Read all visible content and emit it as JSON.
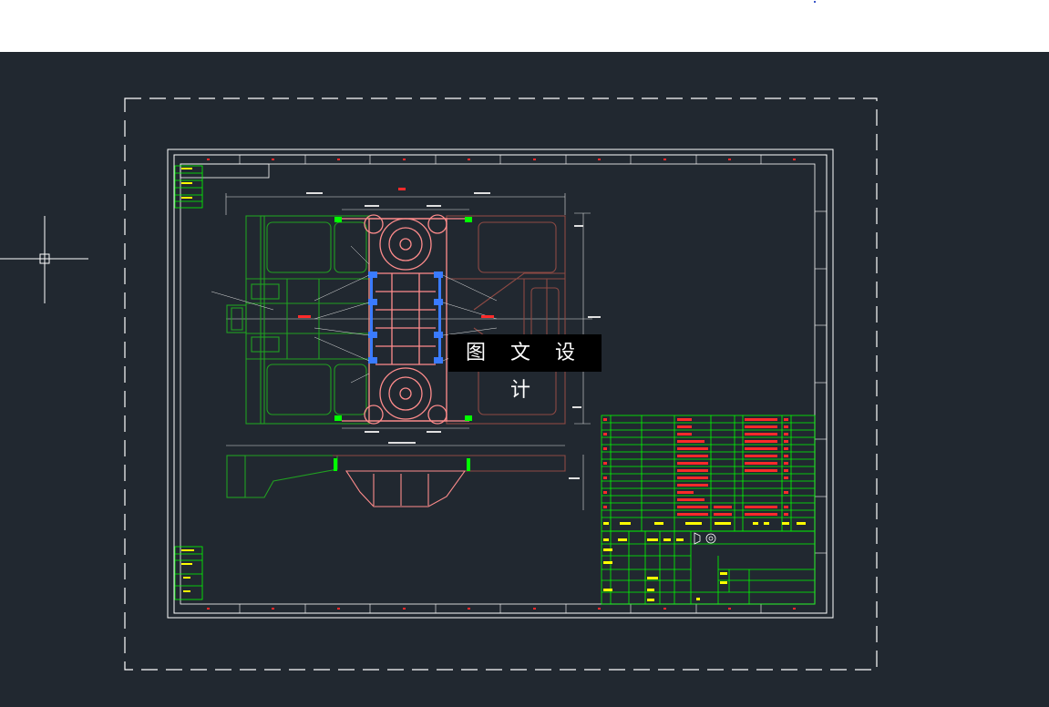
{
  "app": {
    "canvas_background": "#212830",
    "topbar_background": "#ffffff"
  },
  "drawing": {
    "watermark_text": "图 文 设 计",
    "colors": {
      "frame_outer": "#ffffff",
      "frame_inner": "#ffffff",
      "title_block": "#00ff00",
      "part_left": "#21a021",
      "part_center": "#ff8c8c",
      "part_right": "#8e4a44",
      "connectors": "#3a7bff",
      "labels": "#ff2a2a",
      "dimensions": "#e0e0e0"
    },
    "cursor": {
      "icon": "crosshair-cursor-icon"
    }
  }
}
